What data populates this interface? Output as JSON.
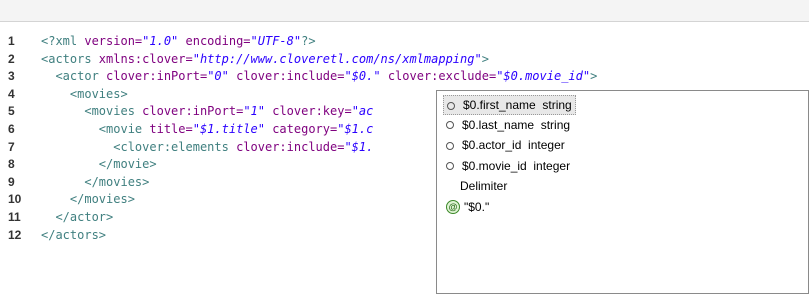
{
  "editor": {
    "lines": [
      {
        "n": "1",
        "segments": [
          {
            "t": "<?xml ",
            "c": "pi"
          },
          {
            "t": "version=",
            "c": "attr"
          },
          {
            "t": "\"1.0\"",
            "c": "val"
          },
          {
            "t": " encoding=",
            "c": "attr"
          },
          {
            "t": "\"UTF-8\"",
            "c": "val"
          },
          {
            "t": "?>",
            "c": "pi"
          }
        ]
      },
      {
        "n": "2",
        "segments": [
          {
            "t": "<actors ",
            "c": "tag"
          },
          {
            "t": "xmlns:clover=",
            "c": "attr"
          },
          {
            "t": "\"http://www.cloveretl.com/ns/xmlmapping\"",
            "c": "val"
          },
          {
            "t": ">",
            "c": "tag"
          }
        ]
      },
      {
        "n": "3",
        "segments": [
          {
            "t": "  <actor ",
            "c": "tag"
          },
          {
            "t": "clover:inPort=",
            "c": "attr"
          },
          {
            "t": "\"0\"",
            "c": "val"
          },
          {
            "t": " clover:include=",
            "c": "attr"
          },
          {
            "t": "\"$0.\"",
            "c": "val"
          },
          {
            "t": " clover:exclude=",
            "c": "attr"
          },
          {
            "t": "\"$0.movie_id\"",
            "c": "val"
          },
          {
            "t": ">",
            "c": "tag"
          }
        ]
      },
      {
        "n": "4",
        "segments": [
          {
            "t": "    <movies>",
            "c": "tag"
          }
        ]
      },
      {
        "n": "5",
        "segments": [
          {
            "t": "      <movies ",
            "c": "tag"
          },
          {
            "t": "clover:inPort=",
            "c": "attr"
          },
          {
            "t": "\"1\"",
            "c": "val"
          },
          {
            "t": " clover:key=",
            "c": "attr"
          },
          {
            "t": "\"ac",
            "c": "val"
          }
        ]
      },
      {
        "n": "6",
        "segments": [
          {
            "t": "        <movie ",
            "c": "tag"
          },
          {
            "t": "title=",
            "c": "attr"
          },
          {
            "t": "\"$1.title\"",
            "c": "val"
          },
          {
            "t": " category=",
            "c": "attr"
          },
          {
            "t": "\"$1.c",
            "c": "val"
          }
        ]
      },
      {
        "n": "7",
        "segments": [
          {
            "t": "          <clover:elements ",
            "c": "tag"
          },
          {
            "t": "clover:include=",
            "c": "attr"
          },
          {
            "t": "\"$1.",
            "c": "val"
          }
        ]
      },
      {
        "n": "8",
        "segments": [
          {
            "t": "        </movie>",
            "c": "tag"
          }
        ]
      },
      {
        "n": "9",
        "segments": [
          {
            "t": "      </movies>",
            "c": "tag"
          }
        ]
      },
      {
        "n": "10",
        "segments": [
          {
            "t": "    </movies>",
            "c": "tag"
          }
        ]
      },
      {
        "n": "11",
        "segments": [
          {
            "t": "  </actor>",
            "c": "tag"
          }
        ]
      },
      {
        "n": "12",
        "segments": [
          {
            "t": "</actors>",
            "c": "tag"
          }
        ]
      }
    ]
  },
  "autocomplete": {
    "items": [
      {
        "label": "$0.first_name  string",
        "icon": "field-bullet-icon",
        "selected": true
      },
      {
        "label": "$0.last_name  string",
        "icon": "field-bullet-icon",
        "selected": false
      },
      {
        "label": "$0.actor_id  integer",
        "icon": "field-bullet-icon",
        "selected": false
      },
      {
        "label": "$0.movie_id  integer",
        "icon": "field-bullet-icon",
        "selected": false
      },
      {
        "label": "Delimiter",
        "icon": "",
        "selected": false
      },
      {
        "label": "\"$0.\"",
        "icon": "at-sign-icon",
        "selected": false
      }
    ],
    "at_icon_glyph": "@"
  }
}
